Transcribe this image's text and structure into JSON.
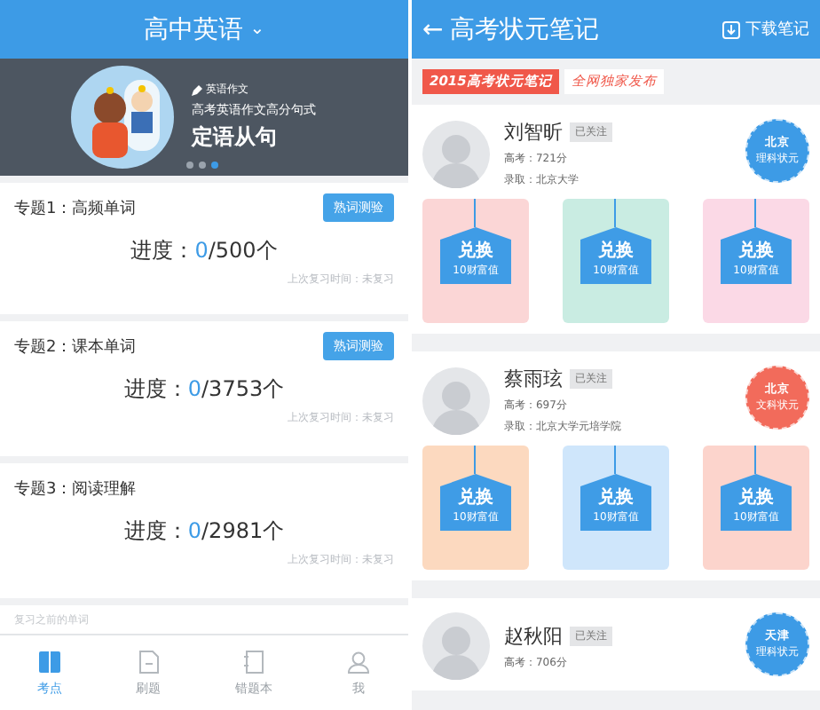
{
  "left": {
    "header": {
      "title": "高中英语",
      "caret": "⌄"
    },
    "banner": {
      "tag": "英语作文",
      "subtitle": "高考英语作文高分句式",
      "title": "定语从句",
      "dots": [
        {
          "selected": false
        },
        {
          "selected": false
        },
        {
          "selected": true
        }
      ]
    },
    "topics": [
      {
        "title": "专题1：高频单词",
        "button": "熟词测验",
        "progress_label": "进度：",
        "done": "0",
        "total": "/500个",
        "last_review": "上次复习时间：未复习"
      },
      {
        "title": "专题2：课本单词",
        "button": "熟词测验",
        "progress_label": "进度：",
        "done": "0",
        "total": "/3753个",
        "last_review": "上次复习时间：未复习"
      },
      {
        "title": "专题3：阅读理解",
        "progress_label": "进度：",
        "done": "0",
        "total": "/2981个",
        "last_review": "上次复习时间：未复习"
      }
    ],
    "review_row": "复习之前的单词",
    "tab_bar": [
      {
        "label": "考点",
        "kind": "book",
        "selected": true
      },
      {
        "label": "刷题",
        "kind": "doc",
        "selected": false
      },
      {
        "label": "错题本",
        "kind": "notebook",
        "selected": false
      },
      {
        "label": "我",
        "kind": "person",
        "selected": false
      }
    ]
  },
  "right": {
    "header": {
      "back": "←",
      "title": "高考状元笔记",
      "download": "下载笔记"
    },
    "ribbon": {
      "tag": "2015高考状元笔记",
      "text": "全网独家发布"
    },
    "students": [
      {
        "name": "刘智昕",
        "follow": "已关注",
        "score": "高考：721分",
        "admission": "录取：北京大学",
        "badge": {
          "region": "北京",
          "title": "理科状元",
          "color": "#3d9be6"
        },
        "notes": [
          {
            "color": "#fbd6d6",
            "exchange": "兑换",
            "price": "10财富值"
          },
          {
            "color": "#c9ece2",
            "exchange": "兑换",
            "price": "10财富值"
          },
          {
            "color": "#fbd9e6",
            "exchange": "兑换",
            "price": "10财富值"
          }
        ]
      },
      {
        "name": "蔡雨玹",
        "follow": "已关注",
        "score": "高考：697分",
        "admission": "录取：北京大学元培学院",
        "badge": {
          "region": "北京",
          "title": "文科状元",
          "color": "#f26b5b"
        },
        "notes": [
          {
            "color": "#fcd9bf",
            "exchange": "兑换",
            "price": "10财富值"
          },
          {
            "color": "#cfe6fb",
            "exchange": "兑换",
            "price": "10财富值"
          },
          {
            "color": "#fcd4cc",
            "exchange": "兑换",
            "price": "10财富值"
          }
        ]
      },
      {
        "name": "赵秋阳",
        "follow": "已关注",
        "score": "高考：706分",
        "badge": {
          "region": "天津",
          "title": "理科状元",
          "color": "#3d9be6"
        }
      }
    ]
  }
}
